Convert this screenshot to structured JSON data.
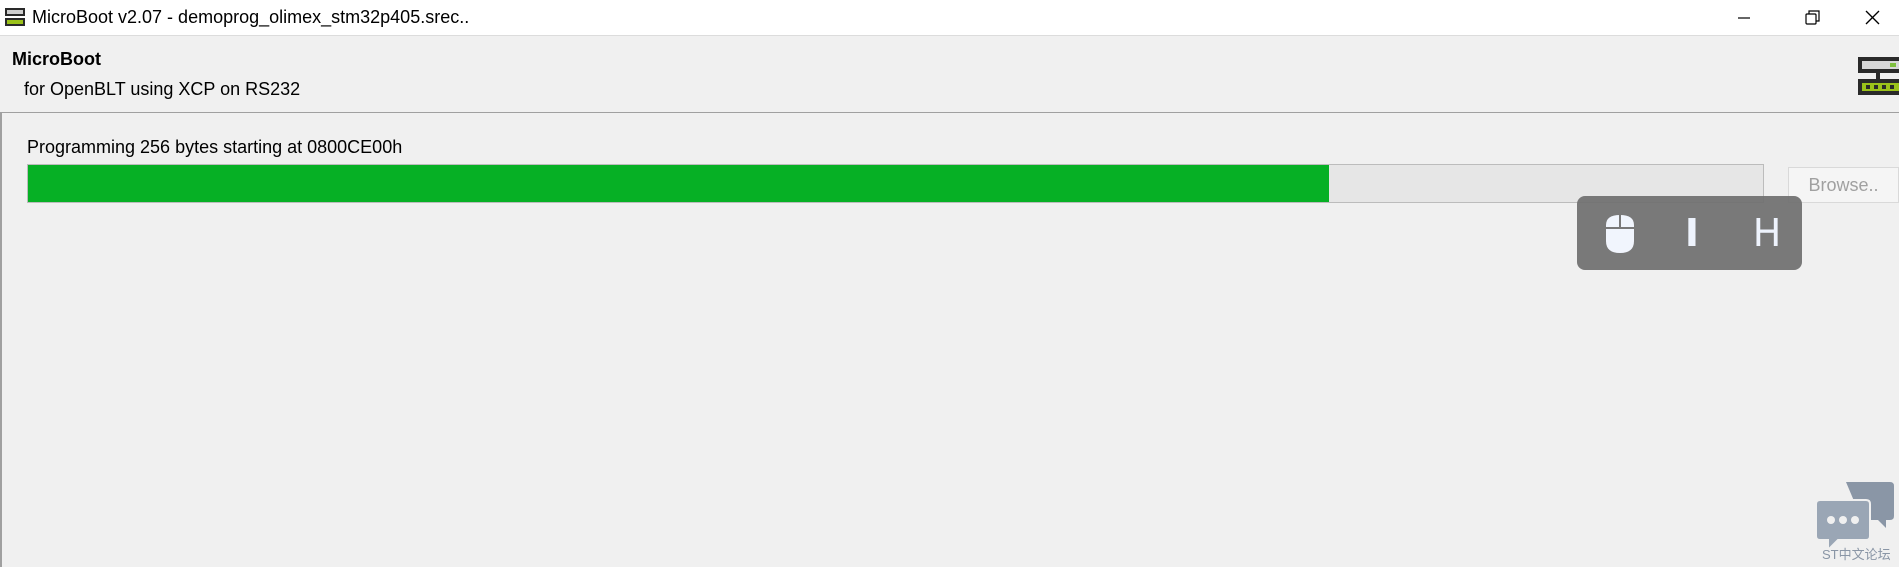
{
  "window": {
    "title": "MicroBoot v2.07 - demoprog_olimex_stm32p405.srec..",
    "icon": "microboot-app-icon",
    "controls": [
      "minimize-icon",
      "restore-icon",
      "close-icon"
    ]
  },
  "header": {
    "title": "MicroBoot",
    "subtitle": "for OpenBLT using XCP on RS232",
    "icon": "microboot-device-icon"
  },
  "main": {
    "status_text": "Programming 256 bytes starting at 0800CE00h",
    "progress_fraction": 0.75,
    "browse_label": "Browse.."
  },
  "overlay": {
    "items": [
      "mouse-icon",
      "I",
      "H"
    ]
  },
  "watermark": {
    "icon": "chat-bubbles-icon",
    "text": "ST中文论坛"
  },
  "colors": {
    "progress_fill": "#06b025",
    "progress_track": "#e6e6e6",
    "window_bg": "#f0f0f0",
    "overlay_bg": "#6f6f6f",
    "watermark": "#8a96a6"
  }
}
